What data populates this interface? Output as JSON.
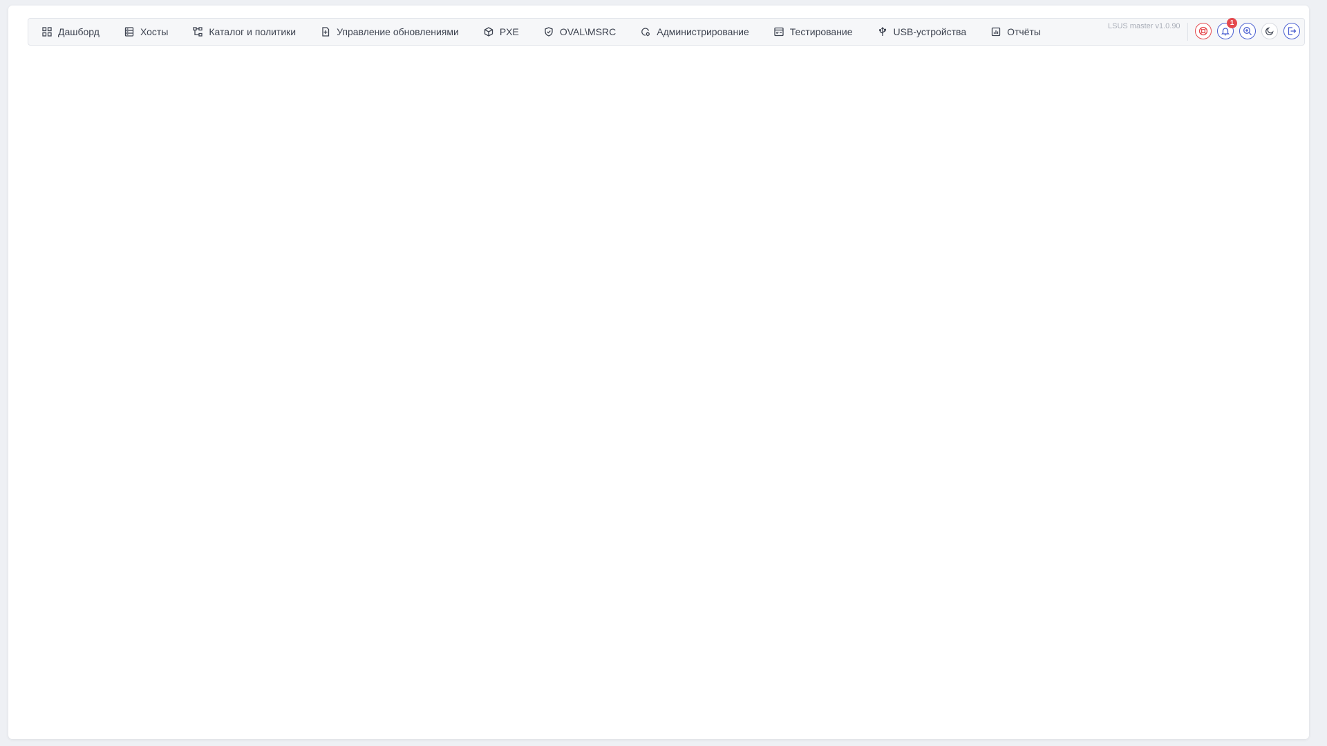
{
  "app": {
    "version": "LSUS master v1.0.90"
  },
  "nav": {
    "items": [
      {
        "label": "Дашборд",
        "icon": "dashboard-grid-icon"
      },
      {
        "label": "Хосты",
        "icon": "server-icon"
      },
      {
        "label": "Каталог и политики",
        "icon": "hierarchy-icon"
      },
      {
        "label": "Управление обновлениями",
        "icon": "file-update-icon"
      },
      {
        "label": "PXE",
        "icon": "box-icon"
      },
      {
        "label": "OVAL\\MSRC",
        "icon": "shield-check-icon"
      },
      {
        "label": "Администрирование",
        "icon": "admin-gear-icon"
      },
      {
        "label": "Тестирование",
        "icon": "checklist-icon"
      },
      {
        "label": "USB-устройства",
        "icon": "usb-icon"
      },
      {
        "label": "Отчёты",
        "icon": "report-chart-icon"
      }
    ]
  },
  "actions": {
    "items": [
      {
        "icon": "support-lifebuoy-icon",
        "color": "#e5484d"
      },
      {
        "icon": "bell-icon",
        "color": "#4a5fd1",
        "badge": "1"
      },
      {
        "icon": "search-zoom-icon",
        "color": "#4a5fd1"
      },
      {
        "icon": "moon-icon",
        "color": "#3d4350"
      },
      {
        "icon": "logout-icon",
        "color": "#4a5fd1"
      }
    ]
  },
  "colors": {
    "accent_red": "#e5484d",
    "accent_blue": "#4a5fd1",
    "text": "#3d4350",
    "muted": "#a9aeb8"
  }
}
